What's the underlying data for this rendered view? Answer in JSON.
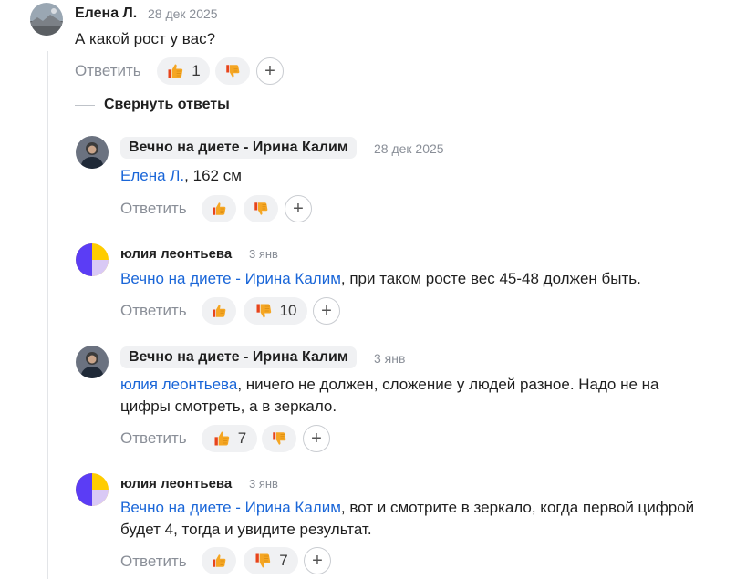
{
  "comments": [
    {
      "author": "Елена Л.",
      "date": "28 дек 2025",
      "text": "А какой рост у вас?",
      "reply": "Ответить",
      "likes": "1",
      "dislikes": ""
    },
    {
      "author": "Вечно на диете - Ирина Калим",
      "date": "28 дек 2025",
      "mention": "Елена Л.",
      "text": ", 162 см",
      "reply": "Ответить",
      "likes": "",
      "dislikes": ""
    },
    {
      "author": "юлия леонтьева",
      "date": "3 янв",
      "mention": "Вечно на диете - Ирина Калим",
      "text": ", при таком росте вес 45-48 должен быть.",
      "reply": "Ответить",
      "likes": "",
      "dislikes": "10"
    },
    {
      "author": "Вечно на диете - Ирина Калим",
      "date": "3 янв",
      "mention": "юлия леонтьева",
      "text": ", ничего не должен, сложение у людей разное. Надо не на цифры смотреть, а в зеркало.",
      "reply": "Ответить",
      "likes": "7",
      "dislikes": ""
    },
    {
      "author": "юлия леонтьева",
      "date": "3 янв",
      "mention": "Вечно на диете - Ирина Калим",
      "text": ", вот и смотрите в зеркало, когда первой цифрой будет 4, тогда и увидите результат.",
      "reply": "Ответить",
      "likes": "",
      "dislikes": "7"
    }
  ],
  "collapse_label": "Свернуть ответы",
  "add_reaction": "+",
  "colors": {
    "mention": "#1a66d8",
    "muted": "#8a8f98",
    "pill": "#f0f1f3",
    "like_icon": "#f5a623",
    "dislike_icon": "#e8441a"
  }
}
